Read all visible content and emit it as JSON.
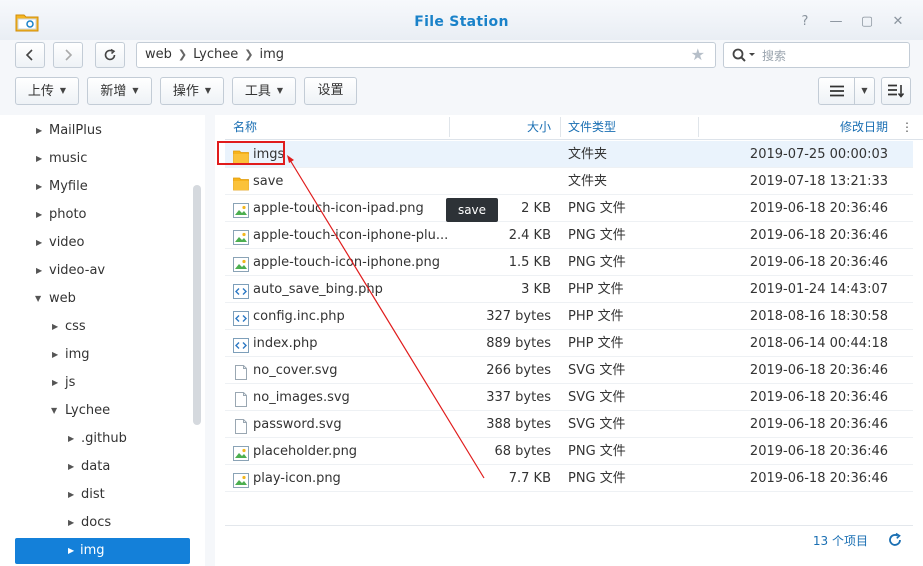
{
  "window": {
    "title": "File Station"
  },
  "nav": {
    "back": "‹",
    "forward": "›",
    "refresh": "↻",
    "path": [
      "web",
      "Lychee",
      "img"
    ],
    "search_placeholder": "搜索"
  },
  "toolbar": {
    "upload": "上传",
    "create": "新增",
    "action": "操作",
    "tools": "工具",
    "settings": "设置"
  },
  "sidebar": {
    "items": [
      {
        "label": "MailPlus",
        "expanded": false
      },
      {
        "label": "music",
        "expanded": false
      },
      {
        "label": "Myfile",
        "expanded": false
      },
      {
        "label": "photo",
        "expanded": false
      },
      {
        "label": "video",
        "expanded": false
      },
      {
        "label": "video-av",
        "expanded": false
      },
      {
        "label": "web",
        "expanded": true
      },
      {
        "label": "css",
        "expanded": false
      },
      {
        "label": "img",
        "expanded": false
      },
      {
        "label": "js",
        "expanded": false
      },
      {
        "label": "Lychee",
        "expanded": true
      },
      {
        "label": ".github",
        "expanded": false
      },
      {
        "label": "data",
        "expanded": false
      },
      {
        "label": "dist",
        "expanded": false
      },
      {
        "label": "docs",
        "expanded": false
      },
      {
        "label": "img",
        "expanded": false,
        "selected": true
      }
    ]
  },
  "table": {
    "columns": {
      "name": "名称",
      "size": "大小",
      "type": "文件类型",
      "date": "修改日期"
    },
    "rows": [
      {
        "icon": "folder-icon",
        "name": "imgs",
        "size": "",
        "type": "文件夹",
        "date": "2019-07-25 00:00:03"
      },
      {
        "icon": "folder-icon",
        "name": "save",
        "size": "",
        "type": "文件夹",
        "date": "2019-07-18 13:21:33"
      },
      {
        "icon": "image-file-icon",
        "name": "apple-touch-icon-ipad.png",
        "size": "2 KB",
        "type": "PNG 文件",
        "date": "2019-06-18 20:36:46"
      },
      {
        "icon": "image-file-icon",
        "name": "apple-touch-icon-iphone-plu...",
        "size": "2.4 KB",
        "type": "PNG 文件",
        "date": "2019-06-18 20:36:46"
      },
      {
        "icon": "image-file-icon",
        "name": "apple-touch-icon-iphone.png",
        "size": "1.5 KB",
        "type": "PNG 文件",
        "date": "2019-06-18 20:36:46"
      },
      {
        "icon": "code-file-icon",
        "name": "auto_save_bing.php",
        "size": "3 KB",
        "type": "PHP 文件",
        "date": "2019-01-24 14:43:07"
      },
      {
        "icon": "code-file-icon",
        "name": "config.inc.php",
        "size": "327 bytes",
        "type": "PHP 文件",
        "date": "2018-08-16 18:30:58"
      },
      {
        "icon": "code-file-icon",
        "name": "index.php",
        "size": "889 bytes",
        "type": "PHP 文件",
        "date": "2018-06-14 00:44:18"
      },
      {
        "icon": "blank-file-icon",
        "name": "no_cover.svg",
        "size": "266 bytes",
        "type": "SVG 文件",
        "date": "2019-06-18 20:36:46"
      },
      {
        "icon": "blank-file-icon",
        "name": "no_images.svg",
        "size": "337 bytes",
        "type": "SVG 文件",
        "date": "2019-06-18 20:36:46"
      },
      {
        "icon": "blank-file-icon",
        "name": "password.svg",
        "size": "388 bytes",
        "type": "SVG 文件",
        "date": "2019-06-18 20:36:46"
      },
      {
        "icon": "image-file-icon",
        "name": "placeholder.png",
        "size": "68 bytes",
        "type": "PNG 文件",
        "date": "2019-06-18 20:36:46"
      },
      {
        "icon": "image-file-icon",
        "name": "play-icon.png",
        "size": "7.7 KB",
        "type": "PNG 文件",
        "date": "2019-06-18 20:36:46"
      }
    ]
  },
  "tooltip": "save",
  "footer": {
    "count": "13 个项目"
  },
  "colors": {
    "accent": "#1480d9",
    "title": "#1a82c9",
    "annotation": "#e01c1c"
  }
}
